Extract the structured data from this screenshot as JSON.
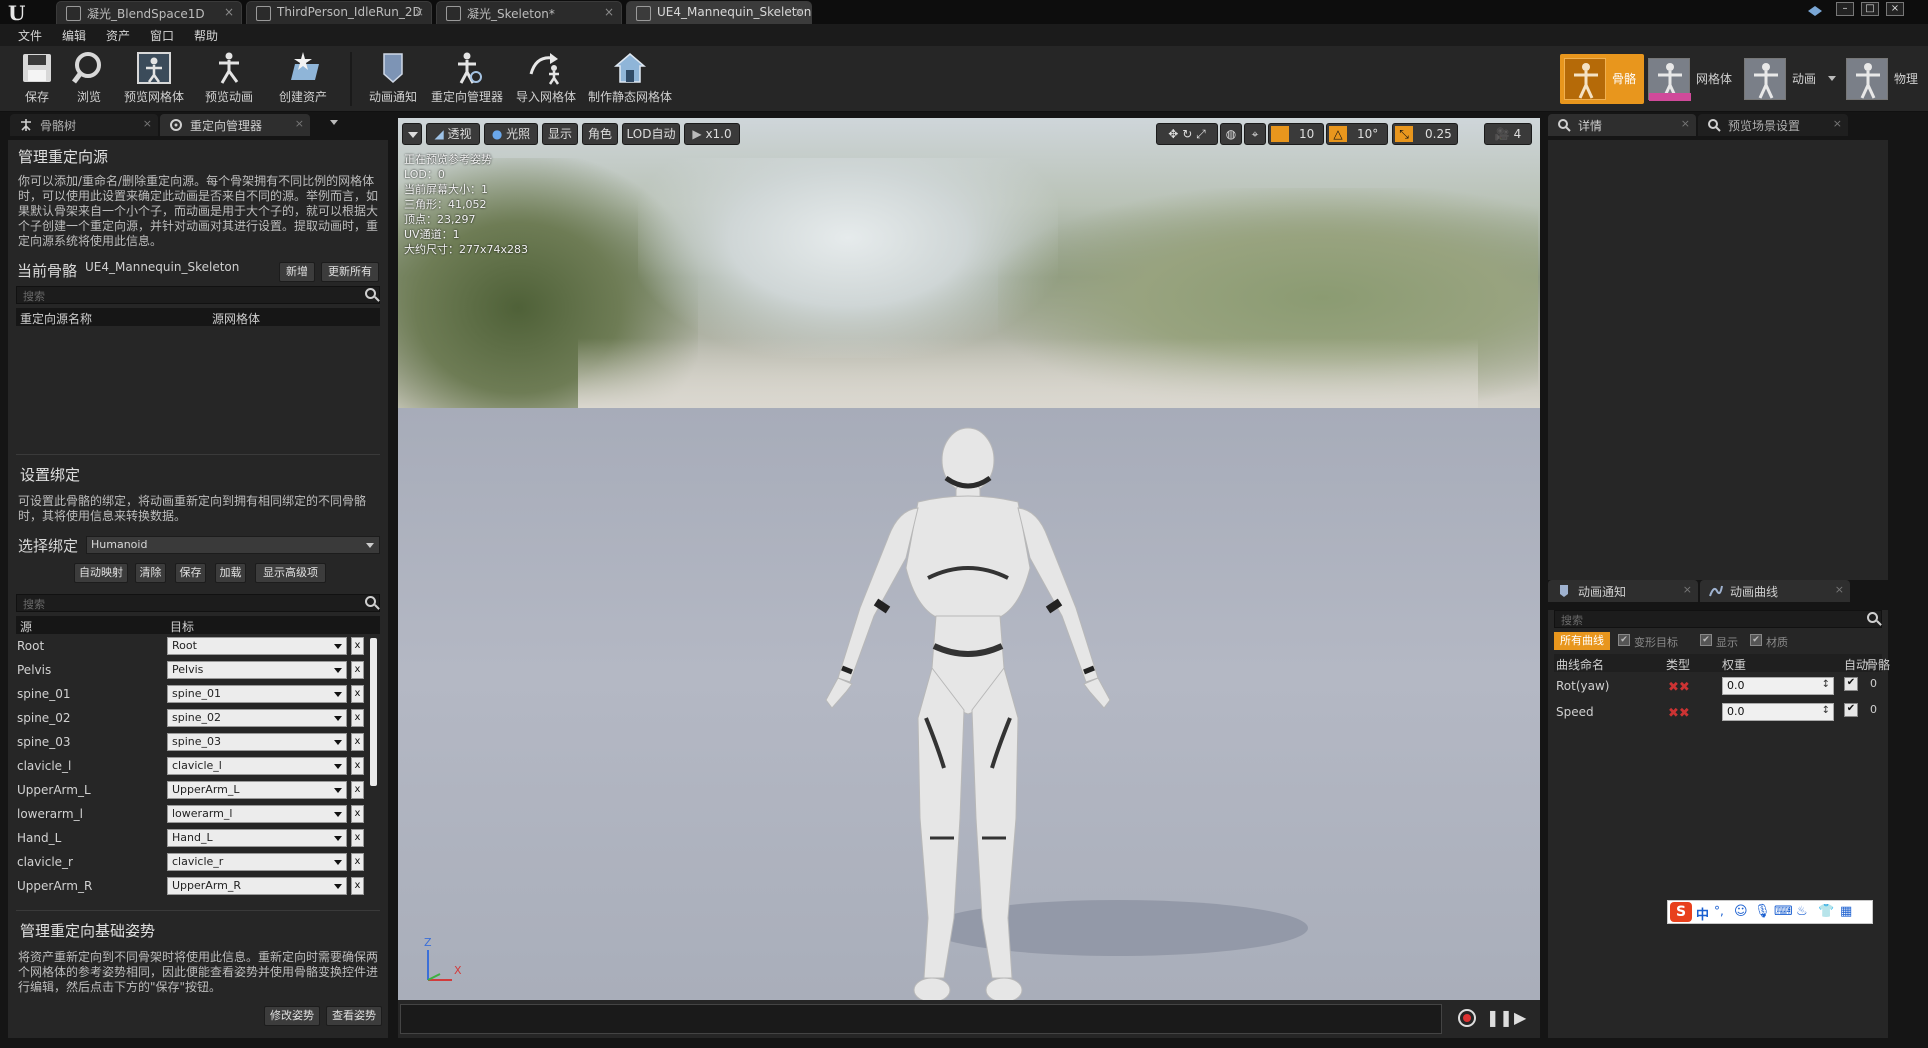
{
  "tabs": [
    {
      "label": "凝光_BlendSpace1D"
    },
    {
      "label": "ThirdPerson_IdleRun_2D"
    },
    {
      "label": "凝光_Skeleton*"
    },
    {
      "label": "UE4_Mannequin_Skeleton"
    }
  ],
  "menu": [
    "文件",
    "编辑",
    "资产",
    "窗口",
    "帮助"
  ],
  "toolbar": {
    "save": "保存",
    "browse": "浏览",
    "preview_mesh": "预览网格体",
    "preview_anim": "预览动画",
    "create_asset": "创建资产",
    "anim_notify": "动画通知",
    "retarget_manager": "重定向管理器",
    "import_mesh": "导入网格体",
    "make_static_mesh": "制作静态网格体"
  },
  "modes": {
    "skeleton": "骨骼",
    "mesh": "网格体",
    "animation": "动画",
    "physics": "物理"
  },
  "left_tabs": {
    "skeleton_tree": "骨骼树",
    "retarget_manager": "重定向管理器"
  },
  "manage_sources": {
    "title": "管理重定向源",
    "desc": "你可以添加/重命名/删除重定向源。每个骨架拥有不同比例的网格体时，可以使用此设置来确定此动画是否来自不同的源。举例而言，如果默认骨架来自一个小个子，而动画是用于大个子的，就可以根据大个子创建一个重定向源，并针对动画对其进行设置。提取动画时，重定向源系统将使用此信息。",
    "current_skeleton_label": "当前骨骼",
    "current_skeleton_value": "UE4_Mannequin_Skeleton",
    "btn_add": "新增",
    "btn_update_all": "更新所有",
    "search_placeholder": "搜索",
    "col_source_name": "重定向源名称",
    "col_source_mesh": "源网格体"
  },
  "rig": {
    "title": "设置绑定",
    "desc": "可设置此骨骼的绑定，将动画重新定向到拥有相同绑定的不同骨骼时，其将使用信息来转换数据。",
    "select_label": "选择绑定",
    "select_value": "Humanoid",
    "btn_auto_map": "自动映射",
    "btn_clear": "清除",
    "btn_save": "保存",
    "btn_load": "加载",
    "btn_advanced": "显示高级项",
    "search_placeholder": "搜索",
    "col_source": "源",
    "col_target": "目标",
    "rows": [
      {
        "src": "Root",
        "tgt": "Root"
      },
      {
        "src": "Pelvis",
        "tgt": "Pelvis"
      },
      {
        "src": "spine_01",
        "tgt": "spine_01"
      },
      {
        "src": "spine_02",
        "tgt": "spine_02"
      },
      {
        "src": "spine_03",
        "tgt": "spine_03"
      },
      {
        "src": "clavicle_l",
        "tgt": "clavicle_l"
      },
      {
        "src": "UpperArm_L",
        "tgt": "UpperArm_L"
      },
      {
        "src": "lowerarm_l",
        "tgt": "lowerarm_l"
      },
      {
        "src": "Hand_L",
        "tgt": "Hand_L"
      },
      {
        "src": "clavicle_r",
        "tgt": "clavicle_r"
      },
      {
        "src": "UpperArm_R",
        "tgt": "UpperArm_R"
      }
    ],
    "x_label": "x"
  },
  "base_pose": {
    "title": "管理重定向基础姿势",
    "desc": "将资产重新定向到不同骨架时将使用此信息。重新定向时需要确保两个网格体的参考姿势相同，因此便能查看姿势并使用骨骼变换控件进行编辑，然后点击下方的\"保存\"按钮。",
    "btn_modify": "修改姿势",
    "btn_view": "查看姿势"
  },
  "viewport": {
    "btn_perspective": "透视",
    "btn_lit": "光照",
    "btn_show": "显示",
    "btn_character": "角色",
    "btn_lod": "LOD自动",
    "btn_speed": "x1.0",
    "grid_value": "10",
    "angle_value": "10°",
    "scale_value": "0.25",
    "cam_value": "4",
    "info": [
      "正在预览参考姿势",
      "LOD：0",
      "当前屏幕大小：1",
      "三角形：41,052",
      "顶点：23,297",
      "UV通道：1",
      "大约尺寸：277x74x283"
    ],
    "axis_z": "Z",
    "axis_x": "X"
  },
  "right_tabs": {
    "details": "详情",
    "preview_scene": "预览场景设置"
  },
  "right_tabs2": {
    "anim_notify": "动画通知",
    "anim_curves": "动画曲线"
  },
  "curves": {
    "search_placeholder": "搜索",
    "filter_all": "所有曲线",
    "filter_morph": "变形目标",
    "filter_show": "显示",
    "filter_material": "材质",
    "col_name": "曲线命名",
    "col_type": "类型",
    "col_weight": "权重",
    "col_auto": "自动",
    "col_bone": "骨骼",
    "rows": [
      {
        "name": "Rot(yaw)",
        "weight": "0.0",
        "bone": "0"
      },
      {
        "name": "Speed",
        "weight": "0.0",
        "bone": "0"
      }
    ]
  },
  "ime": {
    "lang": "中"
  },
  "colors": {
    "accent_orange": "#e8961d",
    "panel_bg": "#262626",
    "titlebar": "#0d0d0d"
  }
}
